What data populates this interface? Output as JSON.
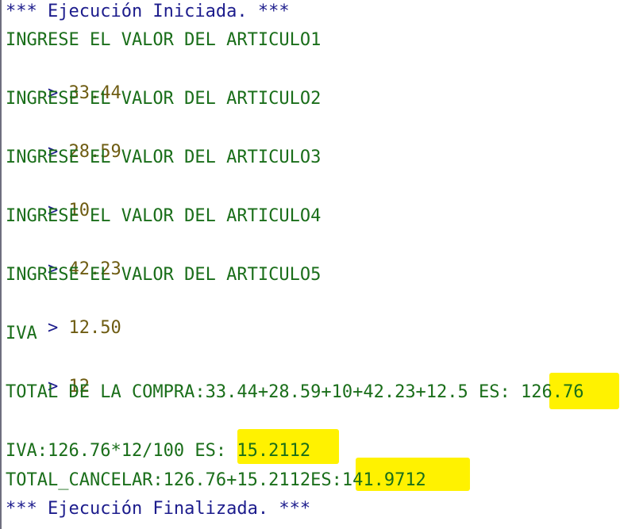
{
  "console": {
    "start_message": "*** Ejecución Iniciada. ***",
    "prompt_symbol": ">",
    "prompts": [
      {
        "label": "INGRESE EL VALOR DEL ARTICULO1",
        "input": "33.44"
      },
      {
        "label": "INGRESE EL VALOR DEL ARTICULO2",
        "input": "28.59"
      },
      {
        "label": "INGRESE EL VALOR DEL ARTICULO3",
        "input": "10"
      },
      {
        "label": "INGRESE EL VALOR DEL ARTICULO4",
        "input": "42.23"
      },
      {
        "label": "INGRESE EL VALOR DEL ARTICULO5",
        "input": "12.50"
      },
      {
        "label": "IVA",
        "input": "12"
      }
    ],
    "total_text": "TOTAL DE LA COMPRA:33.44+28.59+10+42.23+12.5 ES: ",
    "total_value": "126.76",
    "iva_text": "IVA:126.76*12/100 ES: ",
    "iva_value": "15.2112",
    "cancel_text": "TOTAL_CANCELAR:126.76+15.2112ES:",
    "cancel_value": "141.9712",
    "end_message": "*** Ejecución Finalizada. ***",
    "highlight_color": "#fff200",
    "output_color": "#1a6e1a",
    "system_color": "#1c1c8c",
    "input_color": "#6e5c12"
  }
}
